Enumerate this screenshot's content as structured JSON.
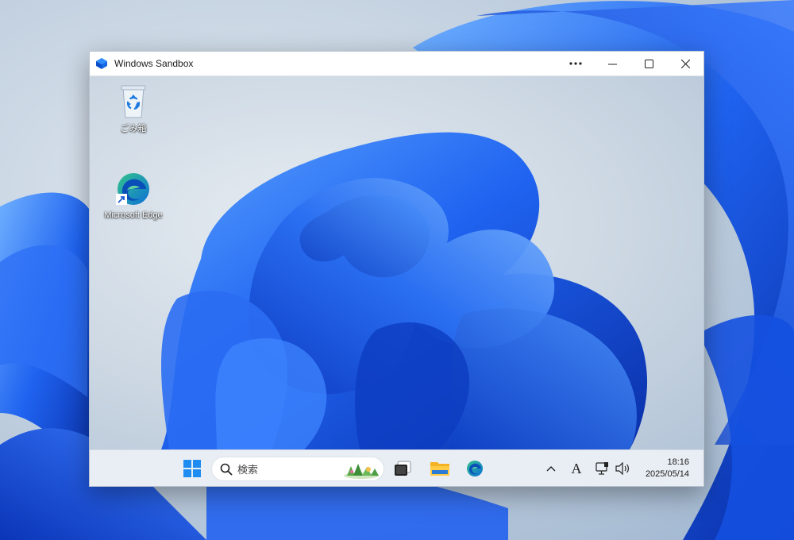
{
  "window": {
    "title": "Windows Sandbox",
    "controls": [
      "more-icon",
      "minimize-icon",
      "maximize-icon",
      "close-icon"
    ]
  },
  "desktop_icons": [
    {
      "label": "ごみ箱",
      "icon": "recycle-bin-icon"
    },
    {
      "label": "Microsoft Edge",
      "icon": "edge-icon"
    }
  ],
  "taskbar": {
    "search_placeholder": "検索",
    "apps": [
      "start-icon",
      "task-view-icon",
      "file-explorer-icon",
      "edge-icon"
    ],
    "tray": [
      "chevron-up-icon",
      "ime-icon",
      "network-icon",
      "volume-icon"
    ],
    "ime_label": "A",
    "time": "18:16",
    "date": "2025/05/14"
  },
  "colors": {
    "accent": "#1a5cf0",
    "bloom_dark": "#0a3fc9",
    "bloom_light": "#3d8bff"
  }
}
